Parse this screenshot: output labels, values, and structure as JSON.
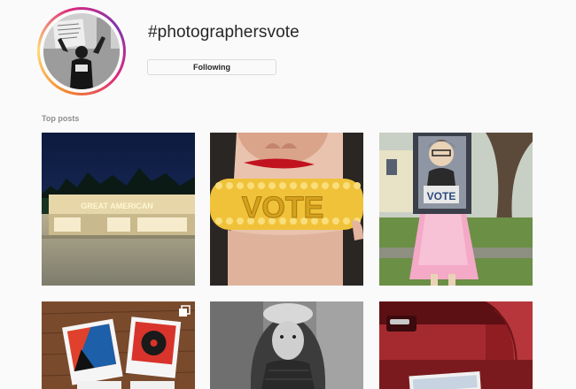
{
  "header": {
    "hashtag": "#photographersvote",
    "follow_button_label": "Following"
  },
  "section": {
    "label": "Top posts"
  },
  "posts": [
    {
      "description": "Great American storefront at dusk",
      "sign_text": "GREAT AMERICAN"
    },
    {
      "description": "Woman biting corn on the cob",
      "corn_text": "VOTE"
    },
    {
      "description": "Girl in pink tutu holding portrait sign",
      "sign_text": "VOTE"
    },
    {
      "description": "Polaroid prints on wooden table",
      "badge": "multiple-photos-icon"
    },
    {
      "description": "Black and white portrait of child in hood"
    },
    {
      "description": "Red car interior with door panel"
    }
  ],
  "colors": {
    "accent_ring": [
      "#f58529",
      "#dd2a7b",
      "#8134af"
    ],
    "text_primary": "#262626",
    "text_secondary": "#8e8e8e"
  }
}
